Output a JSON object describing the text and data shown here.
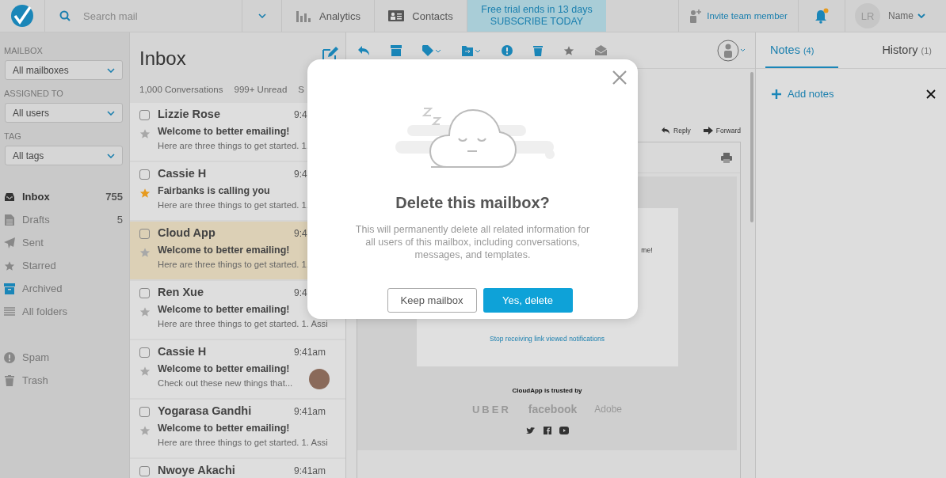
{
  "top_bar": {
    "search": {
      "placeholder": "Search mail"
    },
    "nav": [
      {
        "kind": "analytics",
        "label": "Analytics",
        "selected": false
      },
      {
        "kind": "contacts",
        "label": "Contacts",
        "selected": false
      }
    ],
    "trial": {
      "line_1": "Free trial ends in 13 days",
      "line_2": "SUBSCRIBE TODAY"
    },
    "invite": "Invite team member",
    "user": {
      "initials": "LR",
      "name": "Name"
    }
  },
  "sidebar": {
    "filters": [
      {
        "label": "MAILBOX",
        "value": "All mailboxes"
      },
      {
        "label": "ASSIGNED TO",
        "value": "All users"
      },
      {
        "label": "TAG",
        "value": "All tags"
      }
    ],
    "folders": [
      {
        "kind": "inbox",
        "label": "Inbox",
        "count": "755",
        "selected": true
      },
      {
        "kind": "drafts",
        "label": "Drafts",
        "count": "5",
        "selected": false
      },
      {
        "kind": "sent",
        "label": "Sent",
        "selected": false
      },
      {
        "kind": "starred",
        "label": "Starred",
        "selected": false
      },
      {
        "kind": "archived",
        "label": "Archived",
        "selected": false
      },
      {
        "kind": "all",
        "label": "All folders",
        "selected": false
      }
    ],
    "system_folders": [
      {
        "kind": "spam",
        "label": "Spam",
        "selected": false
      },
      {
        "kind": "trash",
        "label": "Trash",
        "selected": false
      }
    ]
  },
  "inbox": {
    "title": "Inbox",
    "stats": [
      "1,000 Conversations",
      "999+ Unread",
      "S"
    ],
    "conversations": [
      {
        "name": "Lizzie Rose",
        "time": "9:4",
        "subject": "Welcome to better emailing!",
        "preview": "Here are three things to get started. 1.",
        "checked": false,
        "starred": false,
        "selected": false,
        "photo": false
      },
      {
        "name": "Cassie H",
        "time": "9:4",
        "subject": "Fairbanks is calling you",
        "preview": "Here are three things to get started. 1.",
        "checked": false,
        "starred": true,
        "selected": false,
        "photo": false
      },
      {
        "name": "Cloud App",
        "time": "9:4",
        "subject": "Welcome to better emailing!",
        "preview": "Here are three things to get started. 1.",
        "checked": false,
        "starred": false,
        "selected": true,
        "photo": false
      },
      {
        "name": "Ren Xue",
        "time": "9:4",
        "subject": "Welcome to better emailing!",
        "preview": "Here are three things to get started. 1. Assi",
        "checked": false,
        "starred": false,
        "selected": false,
        "photo": false
      },
      {
        "name": "Cassie H",
        "time": "9:41am",
        "subject": "Welcome to better emailing!",
        "preview": "Check out these new things that...",
        "checked": false,
        "starred": false,
        "selected": false,
        "photo": true
      },
      {
        "name": "Yogarasa Gandhi",
        "time": "9:41am",
        "subject": "Welcome to better emailing!",
        "preview": "Here are three things to get started. 1. Assi",
        "checked": false,
        "starred": false,
        "selected": false,
        "photo": false
      },
      {
        "name": "Nwoye Akachi",
        "time": "9:41am",
        "checked": false,
        "selected": false
      }
    ]
  },
  "email": {
    "actions": [
      {
        "kind": "reply",
        "label": "Reply"
      },
      {
        "kind": "forward",
        "label": "Forward"
      }
    ],
    "body_fragment": "me!",
    "unsubscribe_link": "Stop receiving link viewed notifications",
    "trusted_by": "CloudApp is trusted by",
    "logos": [
      "UBER",
      "facebook",
      "Adobe"
    ]
  },
  "notes_panel": {
    "tabs": [
      {
        "label": "Notes",
        "count": "(4)",
        "selected": true
      },
      {
        "label": "History",
        "count": "(1)",
        "selected": false
      }
    ],
    "add_label": "Add notes"
  },
  "dialog": {
    "title": "Delete this mailbox?",
    "message": "This will permanently delete all related information for all users of this mailbox, including conversations, messages, and templates.",
    "buttons": [
      {
        "kind": "secondary",
        "label": "Keep mailbox"
      },
      {
        "kind": "primary",
        "label": "Yes, delete"
      }
    ]
  }
}
